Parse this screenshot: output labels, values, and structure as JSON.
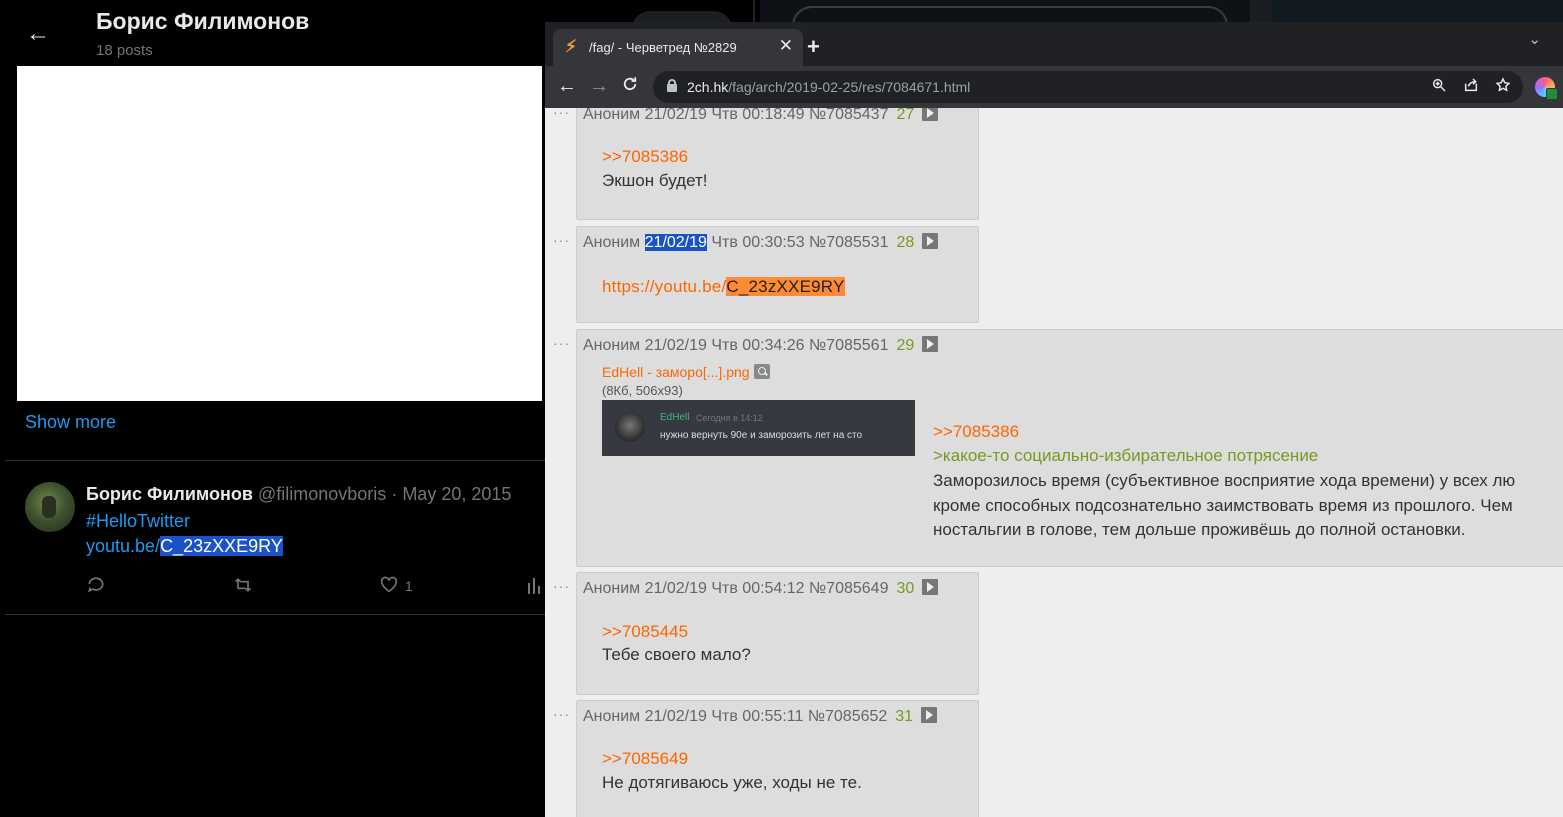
{
  "twitter": {
    "profile_name": "Борис Филимонов",
    "posts_count": "18 posts",
    "show_more": "Show more",
    "tweet": {
      "author": "Борис Филимонов",
      "handle": "@filimonovboris",
      "separator": "·",
      "date": "May 20, 2015",
      "hashtag": "#HelloTwitter",
      "link_prefix": "youtu.be/",
      "link_selected": "C_23zXXE9RY",
      "like_count": "1"
    }
  },
  "browser": {
    "tab_title": "/fag/ - Черветред №2829",
    "url_host": "2ch.hk",
    "url_path": "/fag/arch/2019-02-25/res/7084671.html"
  },
  "posts": [
    {
      "dots": "···",
      "header_pre": "Аноним 21/02/19 Чтв 00:18:49 №7085437",
      "num": "27",
      "reply": ">>7085386",
      "text": "Экшон будет!"
    },
    {
      "dots": "···",
      "header_name": "Аноним",
      "header_date_hl": "21/02/19",
      "header_rest": "Чтв 00:30:53 №7085531",
      "num": "28",
      "link_prefix": "https://youtu.be/",
      "link_hl": "C_23zXXE9RY"
    },
    {
      "dots": "···",
      "header_pre": "Аноним 21/02/19 Чтв 00:34:26 №7085561",
      "num": "29",
      "file_name": "EdHell - заморо[...].png",
      "file_meta": "(8Кб, 506x93)",
      "thumb_user": "EdHell",
      "thumb_time": "Сегодня в 14:12",
      "thumb_msg": "нужно вернуть 90е и заморозить лет на сто",
      "reply": ">>7085386",
      "greentext": ">какое-то социально-избирательное потрясение",
      "lines": [
        "Заморозилось время (субъективное восприятие хода времени) у всех лю",
        "кроме способных подсознательно заимствовать время из прошлого. Чем",
        "ностальгии в голове, тем дольше проживёшь до полной остановки."
      ]
    },
    {
      "dots": "···",
      "header_pre": "Аноним 21/02/19 Чтв 00:54:12 №7085649",
      "num": "30",
      "reply": ">>7085445",
      "text": "Тебе своего мало?"
    },
    {
      "dots": "···",
      "header_pre": "Аноним 21/02/19 Чтв 00:55:11 №7085652",
      "num": "31",
      "reply": ">>7085649",
      "text": "Не дотягиваюсь уже, ходы не те."
    }
  ],
  "icons": {
    "back": "arrow-left-icon",
    "reply": "reply-icon",
    "retweet": "retweet-icon",
    "like": "heart-icon",
    "views": "bar-chart-icon",
    "favicon": "lightning-icon",
    "close": "close-icon",
    "newtab": "plus-icon",
    "reload": "reload-icon",
    "zoom": "zoom-icon",
    "share": "share-icon",
    "bookmark": "star-icon"
  },
  "colors": {
    "twitter_link": "#1d9bf0",
    "selection": "#1a53c6",
    "reply_link": "#ff6600",
    "greentext": "#789922",
    "post_bg": "#dddddd"
  }
}
